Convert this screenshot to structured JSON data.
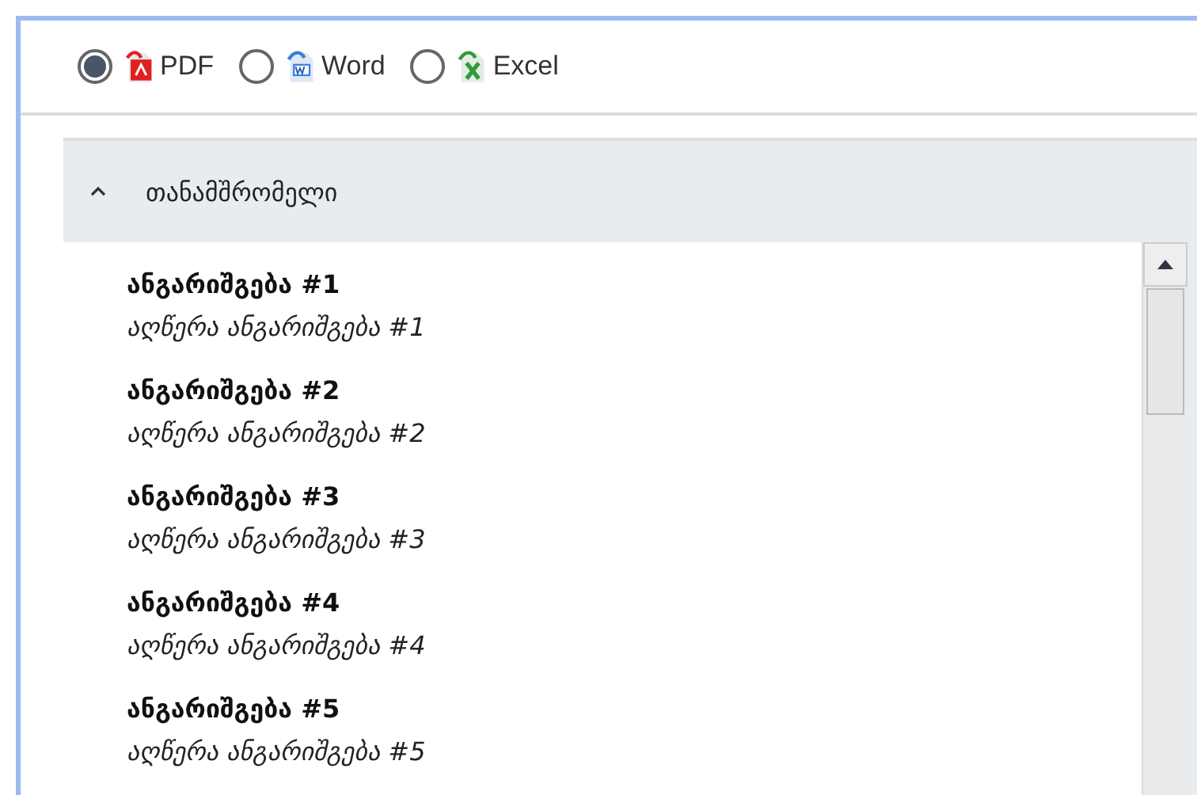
{
  "format_options": [
    {
      "label": "PDF",
      "kind": "pdf",
      "selected": true
    },
    {
      "label": "Word",
      "kind": "word",
      "selected": false
    },
    {
      "label": "Excel",
      "kind": "excel",
      "selected": false
    }
  ],
  "panel": {
    "title": "თანამშრომელი",
    "expanded": true,
    "items": [
      {
        "title": "ანგარიშგება #1",
        "description": "აღწერა ანგარიშგება #1"
      },
      {
        "title": "ანგარიშგება #2",
        "description": "აღწერა ანგარიშგება #2"
      },
      {
        "title": "ანგარიშგება #3",
        "description": "აღწერა ანგარიშგება #3"
      },
      {
        "title": "ანგარიშგება #4",
        "description": "აღწერა ანგარიშგება #4"
      },
      {
        "title": "ანგარიშგება #5",
        "description": "აღწერა ანგარიშგება #5"
      }
    ]
  }
}
